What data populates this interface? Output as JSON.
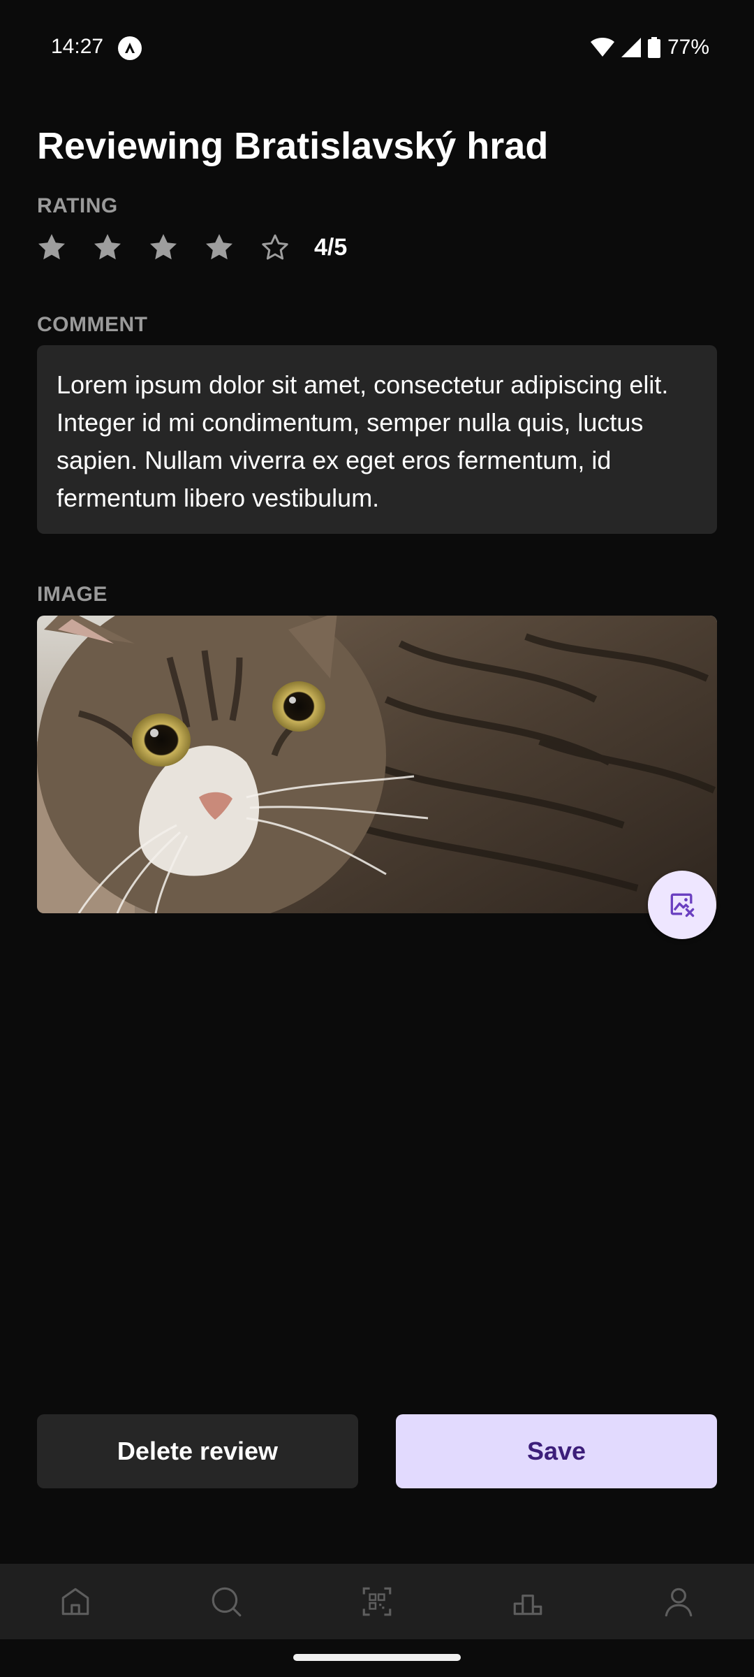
{
  "status_bar": {
    "time": "14:27",
    "battery": "77%",
    "icons": [
      "app-notification-icon",
      "wifi-icon",
      "signal-icon",
      "battery-icon"
    ]
  },
  "page": {
    "title": "Reviewing Bratislavský hrad"
  },
  "rating": {
    "label": "RATING",
    "value": 4,
    "max": 5,
    "display": "4/5"
  },
  "comment": {
    "label": "COMMENT",
    "text": "Lorem ipsum dolor sit amet, consectetur adipiscing elit. Integer id mi condimentum, semper nulla quis, luctus sapien. Nullam viverra ex eget eros fermentum, id fermentum libero vestibulum."
  },
  "image": {
    "label": "IMAGE",
    "remove_icon": "image-remove-icon"
  },
  "actions": {
    "delete_label": "Delete review",
    "save_label": "Save"
  },
  "bottom_nav": {
    "items": [
      "home-icon",
      "search-icon",
      "qr-scan-icon",
      "leaderboard-icon",
      "profile-icon"
    ]
  },
  "colors": {
    "background": "#0b0b0b",
    "surface": "#262626",
    "nav_background": "#1f1f1f",
    "accent_container": "#e2dafe",
    "accent_text": "#3c1e7a",
    "label_gray": "#9a9a9a",
    "star_gray": "#9e9e9e"
  }
}
